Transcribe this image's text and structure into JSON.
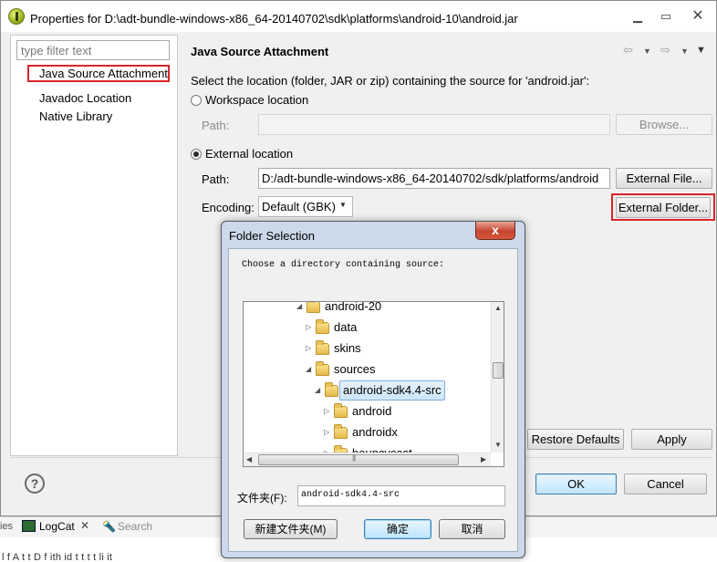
{
  "window": {
    "title": "Properties for D:\\adt-bundle-windows-x86_64-20140702\\sdk\\platforms\\android-10\\android.jar",
    "min": "▁",
    "max": "▭",
    "close": "✕"
  },
  "left": {
    "filter_placeholder": "type filter text",
    "items": [
      "Java Source Attachment",
      "Javadoc Location",
      "Native Library"
    ]
  },
  "page": {
    "title": "Java Source Attachment",
    "description": "Select the location (folder, JAR or zip) containing the source for 'android.jar':",
    "workspace_label": "Workspace location",
    "path_label": "Path:",
    "browse": "Browse...",
    "external_label": "External location",
    "ext_path_value": "D:/adt-bundle-windows-x86_64-20140702/sdk/platforms/android",
    "external_file": "External File...",
    "encoding_label": "Encoding:",
    "encoding_value": "Default (GBK)",
    "external_folder": "External Folder...",
    "restore_defaults": "Restore Defaults",
    "apply": "Apply"
  },
  "footer": {
    "ok": "OK",
    "cancel": "Cancel",
    "help": "?"
  },
  "background": {
    "ies": "ies",
    "logcat": "LogCat",
    "search": "Search",
    "lower_text": "l f          A         t t           D  f  ith id         t    t t t  li it"
  },
  "folder_dialog": {
    "title": "Folder Selection",
    "close": "x",
    "message": "Choose a directory containing source:",
    "tree": [
      {
        "label": "android-20",
        "expanded": true
      },
      {
        "label": "data",
        "expanded": false
      },
      {
        "label": "skins",
        "expanded": false
      },
      {
        "label": "sources",
        "expanded": true
      },
      {
        "label": "android-sdk4.4-src",
        "expanded": true,
        "selected": true
      },
      {
        "label": "android",
        "expanded": false
      },
      {
        "label": "androidx",
        "expanded": false
      },
      {
        "label": "bouncycast",
        "expanded": false
      }
    ],
    "folder_label": "文件夹(F):",
    "folder_value": "android-sdk4.4-src",
    "new_folder": "新建文件夹(M)",
    "confirm": "确定",
    "cancel": "取消"
  }
}
